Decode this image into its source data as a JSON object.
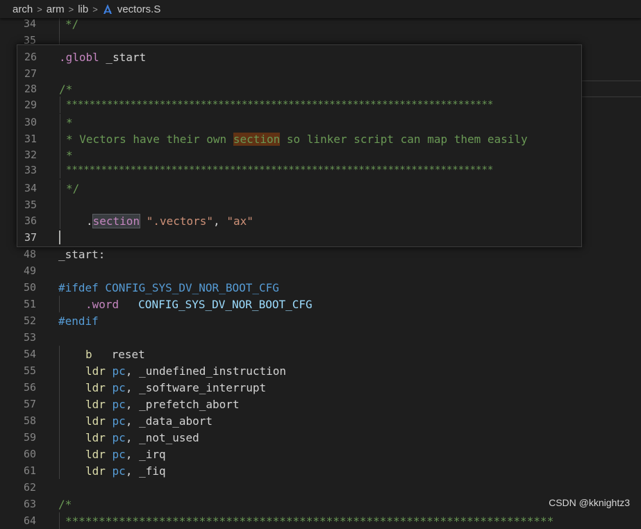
{
  "breadcrumb": {
    "items": [
      "arch",
      "arm",
      "lib"
    ],
    "file": "vectors.S",
    "separator": ">"
  },
  "colors": {
    "background": "#1e1e1e",
    "comment": "#6a9955",
    "directive": "#c586c0",
    "string": "#ce9178",
    "register": "#569cd6",
    "instruction": "#dcdcaa",
    "find_highlight": "#613214"
  },
  "editor_top_lines": [
    {
      "num": "34",
      "text": "*/"
    },
    {
      "num": "35",
      "text": ""
    }
  ],
  "peek": {
    "lines": [
      {
        "num": "26",
        "a": ".globl",
        "b": " _start"
      },
      {
        "num": "27"
      },
      {
        "num": "28",
        "text": "/*"
      },
      {
        "num": "29",
        "text": "*************************************************************************"
      },
      {
        "num": "30",
        "text": "*"
      },
      {
        "num": "31",
        "pre": "* Vectors have their own ",
        "match": "section",
        "post": " so linker script can map them easily"
      },
      {
        "num": "32",
        "text": "*"
      },
      {
        "num": "33",
        "text": "*************************************************************************"
      },
      {
        "num": "34",
        "text": "*/"
      },
      {
        "num": "35"
      },
      {
        "num": "36",
        "dot": ".",
        "dir": "section",
        "s1": "\".vectors\"",
        "comma": ", ",
        "s2": "\"ax\""
      },
      {
        "num": "37"
      }
    ]
  },
  "editor_lines": [
    {
      "num": "48",
      "label": "_start:"
    },
    {
      "num": "49"
    },
    {
      "num": "50",
      "ifdef": "#ifdef",
      "macro": " CONFIG_SYS_DV_NOR_BOOT_CFG"
    },
    {
      "num": "51",
      "word": ".word",
      "arg": "CONFIG_SYS_DV_NOR_BOOT_CFG"
    },
    {
      "num": "52",
      "endif": "#endif"
    },
    {
      "num": "53"
    },
    {
      "num": "54",
      "ins": "b",
      "target": "reset"
    },
    {
      "num": "55",
      "ins": "ldr",
      "reg": "pc",
      "target": "_undefined_instruction"
    },
    {
      "num": "56",
      "ins": "ldr",
      "reg": "pc",
      "target": "_software_interrupt"
    },
    {
      "num": "57",
      "ins": "ldr",
      "reg": "pc",
      "target": "_prefetch_abort"
    },
    {
      "num": "58",
      "ins": "ldr",
      "reg": "pc",
      "target": "_data_abort"
    },
    {
      "num": "59",
      "ins": "ldr",
      "reg": "pc",
      "target": "_not_used"
    },
    {
      "num": "60",
      "ins": "ldr",
      "reg": "pc",
      "target": "_irq"
    },
    {
      "num": "61",
      "ins": "ldr",
      "reg": "pc",
      "target": "_fiq"
    },
    {
      "num": "62"
    },
    {
      "num": "63",
      "text": "/*"
    },
    {
      "num": "64",
      "text": "*************************************************************************"
    }
  ],
  "watermark": "CSDN @kknightz3"
}
